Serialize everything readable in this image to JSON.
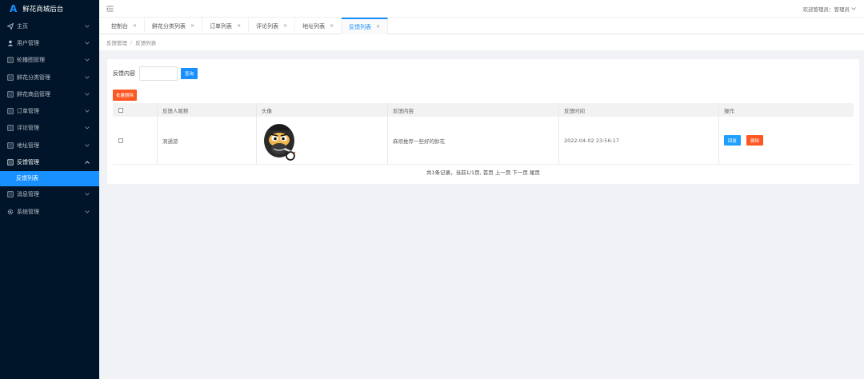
{
  "app": {
    "title": "鲜花商城后台",
    "logo_letter": "A"
  },
  "sidebar": {
    "items": [
      {
        "icon": "send-icon",
        "label": "主页"
      },
      {
        "icon": "user-icon",
        "label": "用户管理"
      },
      {
        "icon": "doc-icon",
        "label": "轮播图管理"
      },
      {
        "icon": "doc-icon",
        "label": "鲜花分类管理"
      },
      {
        "icon": "doc-icon",
        "label": "鲜花商品管理"
      },
      {
        "icon": "doc-icon",
        "label": "订单管理"
      },
      {
        "icon": "doc-icon",
        "label": "评论管理"
      },
      {
        "icon": "doc-icon",
        "label": "地址管理"
      },
      {
        "icon": "doc-icon",
        "label": "反馈管理",
        "expanded": true
      },
      {
        "icon": "doc-icon",
        "label": "消息管理"
      },
      {
        "icon": "gear-icon",
        "label": "系统管理"
      }
    ],
    "active_sub": "反馈列表"
  },
  "header": {
    "user_text": "欢迎管理员：管理员"
  },
  "tabs": [
    {
      "label": "控制台"
    },
    {
      "label": "鲜花分类列表"
    },
    {
      "label": "订单列表"
    },
    {
      "label": "评论列表"
    },
    {
      "label": "地址列表"
    },
    {
      "label": "反馈列表",
      "active": true
    }
  ],
  "breadcrumb": {
    "parent": "反馈管理",
    "current": "反馈列表",
    "separator": "/"
  },
  "search": {
    "label": "反馈内容",
    "button": "查询"
  },
  "batch_delete_label": "批量删除",
  "table": {
    "columns": [
      "",
      "反馈人昵称",
      "头像",
      "反馈内容",
      "反馈时间",
      "操作"
    ],
    "rows": [
      {
        "nickname": "洞通游",
        "avatar": "gorilla-avatar",
        "content": "麻烦推荐一些好的鲜花",
        "time": "2022-04-02 23:56:17",
        "reply_label": "回复",
        "delete_label": "删除"
      }
    ]
  },
  "pager": {
    "text": "共1条记录，当前1/1页, 首页 上一页 下一页 尾页"
  },
  "colors": {
    "sidebar_bg": "#001529",
    "accent": "#1890ff",
    "danger": "#ff5722",
    "reply": "#1e9fff"
  }
}
